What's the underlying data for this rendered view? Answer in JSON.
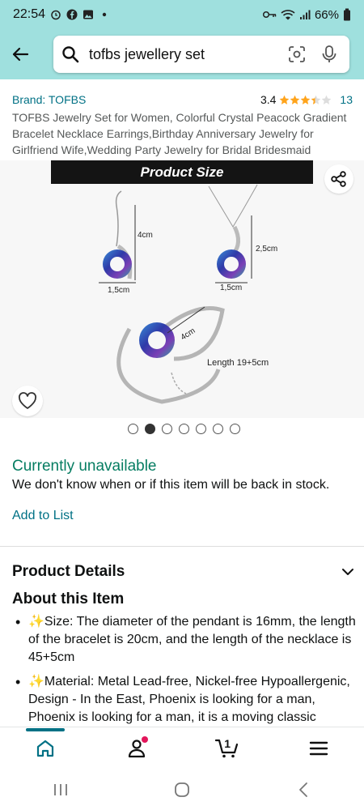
{
  "status_bar": {
    "time": "22:54",
    "battery": "66%"
  },
  "search": {
    "query": "tofbs jewellery set"
  },
  "product": {
    "brand": "Brand: TOFBS",
    "rating": "3.4",
    "rating_stars": 3.4,
    "review_count": "13",
    "title": "TOFBS Jewelry Set for Women, Colorful Crystal Peacock Gradient Bracelet Necklace Earrings,Birthday Anniversary Jewelry for Girlfriend Wife,Wedding Party Jewelry for Bridal Bridesmaid"
  },
  "image": {
    "banner": "Product Size",
    "labels": {
      "earring_height": "4cm",
      "earring_width": "1,5cm",
      "pendant_height": "2,5cm",
      "pendant_width": "1,5cm",
      "bracelet_width": "4cm",
      "bracelet_length": "Length 19+5cm"
    },
    "carousel_total": 7,
    "carousel_active": 2
  },
  "availability": {
    "status": "Currently unavailable",
    "note": "We don't know when or if this item will be back in stock.",
    "add_to_list": "Add to List"
  },
  "details": {
    "product_details_title": "Product Details",
    "about_title": "About this Item",
    "bullets": [
      "✨Size: The diameter of the pendant is 16mm, the length of the bracelet is 20cm, and the length of the necklace is 45+5cm",
      "✨Material: Metal Lead-free, Nickel-free Hypoallergenic, Design - In the East, Phoenix is looking for a man, Phoenix is looking for a man, it is a moving classic"
    ]
  },
  "bottom_nav": {
    "cart_count": "1"
  },
  "colors": {
    "header_bg": "#9fe0de",
    "link": "#007185",
    "available_green": "#067d62",
    "star": "#ffa41c",
    "badge": "#e3165b"
  }
}
